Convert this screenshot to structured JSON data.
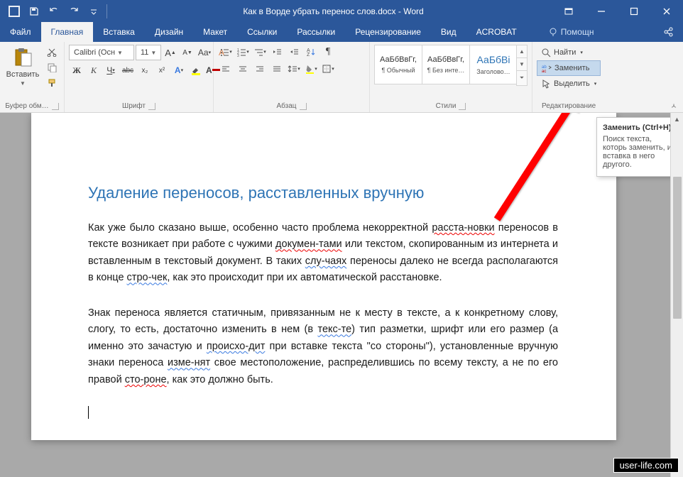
{
  "title": "Как в Ворде убрать перенос слов.docx - Word",
  "tabs": [
    "Файл",
    "Главная",
    "Вставка",
    "Дизайн",
    "Макет",
    "Ссылки",
    "Рассылки",
    "Рецензирование",
    "Вид",
    "ACROBAT"
  ],
  "active_tab": 1,
  "tell_me": "Помощн",
  "share": "",
  "clipboard": {
    "paste": "Вставить",
    "label": "Буфер обм…"
  },
  "font": {
    "name": "Calibri (Осн",
    "size": "11",
    "buttons_row1": [
      "Aa",
      "A"
    ],
    "bold": "Ж",
    "italic": "К",
    "under": "Ч",
    "strike": "abc",
    "sub": "x₂",
    "sup": "x²",
    "label": "Шрифт"
  },
  "para": {
    "label": "Абзац"
  },
  "styles": {
    "items": [
      {
        "preview": "АаБбВвГг,",
        "name": "¶ Обычный",
        "cls": ""
      },
      {
        "preview": "АаБбВвГг,",
        "name": "¶ Без инте…",
        "cls": ""
      },
      {
        "preview": "АаБбВі",
        "name": "Заголово…",
        "cls": "heading"
      }
    ],
    "label": "Стили"
  },
  "editing": {
    "find": "Найти",
    "replace": "Заменить",
    "select": "Выделить",
    "label": "Редактирование"
  },
  "tooltip": {
    "title": "Заменить (Ctrl+H)",
    "body": "Поиск текста, которь заменить, и вставка в него другого."
  },
  "doc": {
    "h2": "Удаление переносов, расставленных вручную",
    "p1a": "Как уже было сказано выше, особенно часто проблема некорректной ",
    "p1b": "расста-новки",
    "p1c": " переносов в тексте возникает при работе с чужими ",
    "p1d": "докумен-тами",
    "p1e": " или текстом, скопированным из интернета и вставленным в текстовый документ. В таких ",
    "p1f": "слу-чаях",
    "p1g": " переносы далеко не всегда располагаются в конце ",
    "p1h": "стро-чек",
    "p1i": ", как это происходит при их автоматической расстановке.",
    "p2a": "Знак переноса является статичным, привязанным не к месту в тексте, а к конкретному слову, слогу, то есть, достаточно изменить в нем (в ",
    "p2b": "текс-те",
    "p2c": ") тип разметки, шрифт или его размер (а именно это зачастую и ",
    "p2d": "происхо-дит",
    "p2e": " при вставке текста \"со стороны\"), установленные вручную знаки переноса ",
    "p2f": "изме-нят",
    "p2g": " свое местоположение, распределившись по всему тексту, а не по его правой ",
    "p2h": "сто-роне",
    "p2i": ", как это должно быть."
  },
  "watermark": "user-life.com"
}
